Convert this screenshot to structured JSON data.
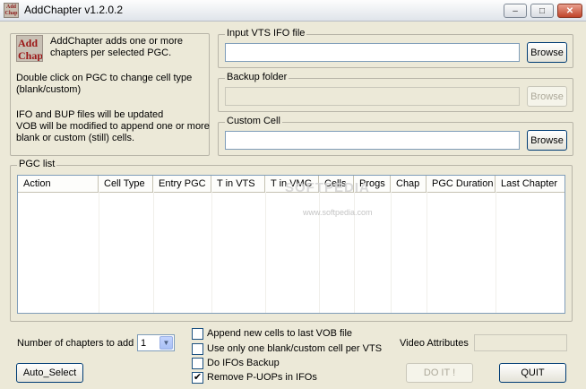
{
  "window": {
    "title": "AddChapter v1.2.0.2",
    "icon_text": "Add Chap",
    "minimize_glyph": "–",
    "maximize_glyph": "□",
    "close_glyph": "✕"
  },
  "info": {
    "logo_text_1": "Add",
    "logo_text_2": "Chap",
    "line1": "AddChapter adds one or more",
    "line2": "chapters per selected PGC.",
    "line3": "Double click on PGC to change cell type",
    "line4": "(blank/custom)",
    "line5": "IFO and BUP files will be updated",
    "line6": "VOB will be modified to append one or more",
    "line7": "blank or custom (still) cells."
  },
  "input_vts": {
    "label": "Input VTS IFO file",
    "value": "",
    "browse_label": "Browse"
  },
  "backup_folder": {
    "label": "Backup folder",
    "value": "",
    "browse_label": "Browse"
  },
  "custom_cell": {
    "label": "Custom Cell",
    "value": "",
    "browse_label": "Browse"
  },
  "pgc_list": {
    "label": "PGC list",
    "columns": [
      "Action",
      "Cell Type",
      "Entry PGC",
      "T in VTS",
      "T in VMG",
      "Cells",
      "Progs",
      "Chap",
      "PGC Duration",
      "Last Chapter"
    ],
    "rows": []
  },
  "watermark": {
    "text": "SOFTPEDIA",
    "url": "www.softpedia.com"
  },
  "chapters": {
    "label": "Number of chapters to add",
    "selected": "1"
  },
  "options": [
    {
      "label": "Append new cells to last VOB file",
      "checked": false
    },
    {
      "label": "Use only one blank/custom cell per VTS",
      "checked": false
    },
    {
      "label": "Do IFOs Backup",
      "checked": false
    },
    {
      "label": "Remove P-UOPs in IFOs",
      "checked": true
    }
  ],
  "video_attributes": {
    "label": "Video Attributes",
    "value": ""
  },
  "buttons": {
    "auto_select": "Auto_Select",
    "do_it": "DO IT !",
    "quit": "QUIT"
  },
  "check_glyph": "✔"
}
